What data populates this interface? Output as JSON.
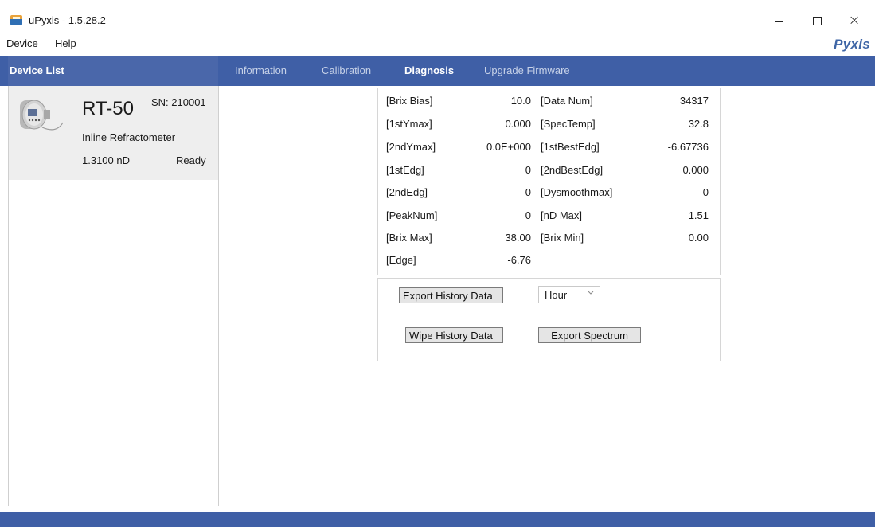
{
  "window": {
    "title": "uPyxis - 1.5.28.2",
    "minimize_symbol": "",
    "close_symbol": "×"
  },
  "menu": {
    "device": "Device",
    "help": "Help",
    "brand": "Pyxis"
  },
  "device_list": {
    "title": "Device List",
    "device": {
      "model": "RT-50",
      "serial": "SN: 210001",
      "type": "Inline Refractometer",
      "reading": "1.3100  nD",
      "status": "Ready"
    }
  },
  "tabs": [
    {
      "label": "Information",
      "active": false
    },
    {
      "label": "Calibration",
      "active": false
    },
    {
      "label": "Diagnosis",
      "active": true
    },
    {
      "label": "Upgrade Firmware",
      "active": false
    }
  ],
  "diagnosis": {
    "rows": [
      {
        "label1": "[Brix Bias]",
        "value1": "10.0",
        "label2": "[Data Num]",
        "value2": "34317"
      },
      {
        "label1": "[1stYmax]",
        "value1": "0.000",
        "label2": "[SpecTemp]",
        "value2": "32.8"
      },
      {
        "label1": "[2ndYmax]",
        "value1": "0.0E+000",
        "label2": "[1stBestEdg]",
        "value2": "-6.67736"
      },
      {
        "label1": "[1stEdg]",
        "value1": "0",
        "label2": "[2ndBestEdg]",
        "value2": "0.000"
      },
      {
        "label1": "[2ndEdg]",
        "value1": "0",
        "label2": "[Dysmoothmax]",
        "value2": "0"
      },
      {
        "label1": "[PeakNum]",
        "value1": "0",
        "label2": "[nD Max]",
        "value2": "1.51"
      },
      {
        "label1": "[Brix Max]",
        "value1": "38.00",
        "label2": "[Brix Min]",
        "value2": "0.00"
      },
      {
        "label1": "[Edge]",
        "value1": "-6.76",
        "label2": "",
        "value2": ""
      }
    ]
  },
  "actions": {
    "export_history": "Export History Data",
    "wipe_history": "Wipe History Data",
    "export_spectrum": "Export Spectrum",
    "interval_selected": "Hour"
  },
  "colors": {
    "header_blue": "#3f5fa6",
    "brand_blue": "#3f66a6"
  }
}
